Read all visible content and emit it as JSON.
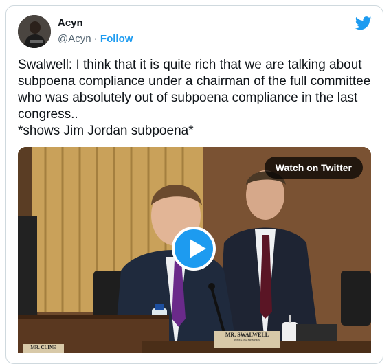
{
  "author": {
    "name": "Acyn",
    "handle": "@Acyn",
    "separator": "·",
    "follow_label": "Follow"
  },
  "tweet": {
    "text": "Swalwell: I think that it is quite rich that we are talking about subpoena compliance under a chairman of the full committee who was absolutely out of subpoena compliance in the last congress..\n*shows Jim Jordan subpoena*"
  },
  "media": {
    "watch_label": "Watch on Twitter",
    "nameplate_main": "MR. SWALWELL",
    "nameplate_sub": "RANKING MEMBER",
    "nameplate_left": "MR. CLINE"
  },
  "colors": {
    "accent": "#1d9bf0",
    "text": "#0f1419",
    "muted": "#536471"
  },
  "icons": {
    "logo": "twitter-bird-icon",
    "play": "play-icon"
  }
}
